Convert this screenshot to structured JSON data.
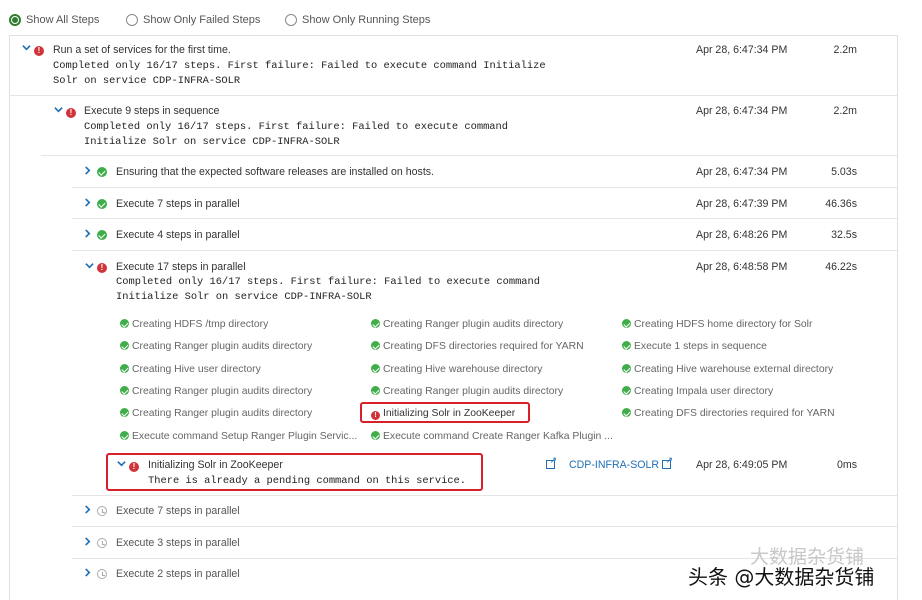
{
  "filters": [
    {
      "label": "Show All Steps",
      "selected": true
    },
    {
      "label": "Show Only Failed Steps",
      "selected": false
    },
    {
      "label": "Show Only Running Steps",
      "selected": false
    }
  ],
  "root": {
    "title": "Run a set of services for the first time.",
    "message_line1": "Completed only 16/17 steps. First failure: Failed to execute command Initialize",
    "message_line2": "Solr on service CDP-INFRA-SOLR",
    "time": "Apr 28, 6:47:34 PM",
    "duration": "2.2m"
  },
  "sequence": {
    "title": "Execute 9 steps in sequence",
    "message_line1": "Completed only 16/17 steps. First failure: Failed to execute command",
    "message_line2": "Initialize Solr on service CDP-INFRA-SOLR",
    "time": "Apr 28, 6:47:34 PM",
    "duration": "2.2m"
  },
  "steps": [
    {
      "title": "Ensuring that the expected software releases are installed on hosts.",
      "time": "Apr 28, 6:47:34 PM",
      "duration": "5.03s",
      "status": "ok"
    },
    {
      "title": "Execute 7 steps in parallel",
      "time": "Apr 28, 6:47:39 PM",
      "duration": "46.36s",
      "status": "ok"
    },
    {
      "title": "Execute 4 steps in parallel",
      "time": "Apr 28, 6:48:26 PM",
      "duration": "32.5s",
      "status": "ok"
    }
  ],
  "parallel17": {
    "title": "Execute 17 steps in parallel",
    "message_line1": "Completed only 16/17 steps. First failure: Failed to execute command",
    "message_line2": "Initialize Solr on service CDP-INFRA-SOLR",
    "time": "Apr 28, 6:48:58 PM",
    "duration": "46.22s"
  },
  "substeps": {
    "col1": [
      "Creating HDFS /tmp directory",
      "Creating Ranger plugin audits directory",
      "Creating Hive user directory",
      "Creating Ranger plugin audits directory",
      "Creating Ranger plugin audits directory",
      "Execute command Setup Ranger Plugin Servic..."
    ],
    "col2": [
      "Creating Ranger plugin audits directory",
      "Creating DFS directories required for YARN",
      "Creating Hive warehouse directory",
      "Creating Ranger plugin audits directory",
      "Initializing Solr in ZooKeeper",
      "Execute command Create Ranger Kafka Plugin ..."
    ],
    "col3": [
      "Creating HDFS home directory for Solr",
      "Execute 1 steps in sequence",
      "Creating Hive warehouse external directory",
      "Creating Impala user directory",
      "Creating DFS directories required for YARN"
    ]
  },
  "failed_detail": {
    "title": "Initializing Solr in ZooKeeper",
    "message": "There is already a pending command on this service.",
    "service_link": "CDP-INFRA-SOLR",
    "time": "Apr 28, 6:49:05 PM",
    "duration": "0ms"
  },
  "pending": [
    {
      "title": "Execute 7 steps in parallel"
    },
    {
      "title": "Execute 3 steps in parallel"
    },
    {
      "title": "Execute 2 steps in parallel"
    }
  ],
  "watermark": {
    "text": "头条 @大数据杂货铺",
    "faded_text": "大数据杂货铺"
  }
}
